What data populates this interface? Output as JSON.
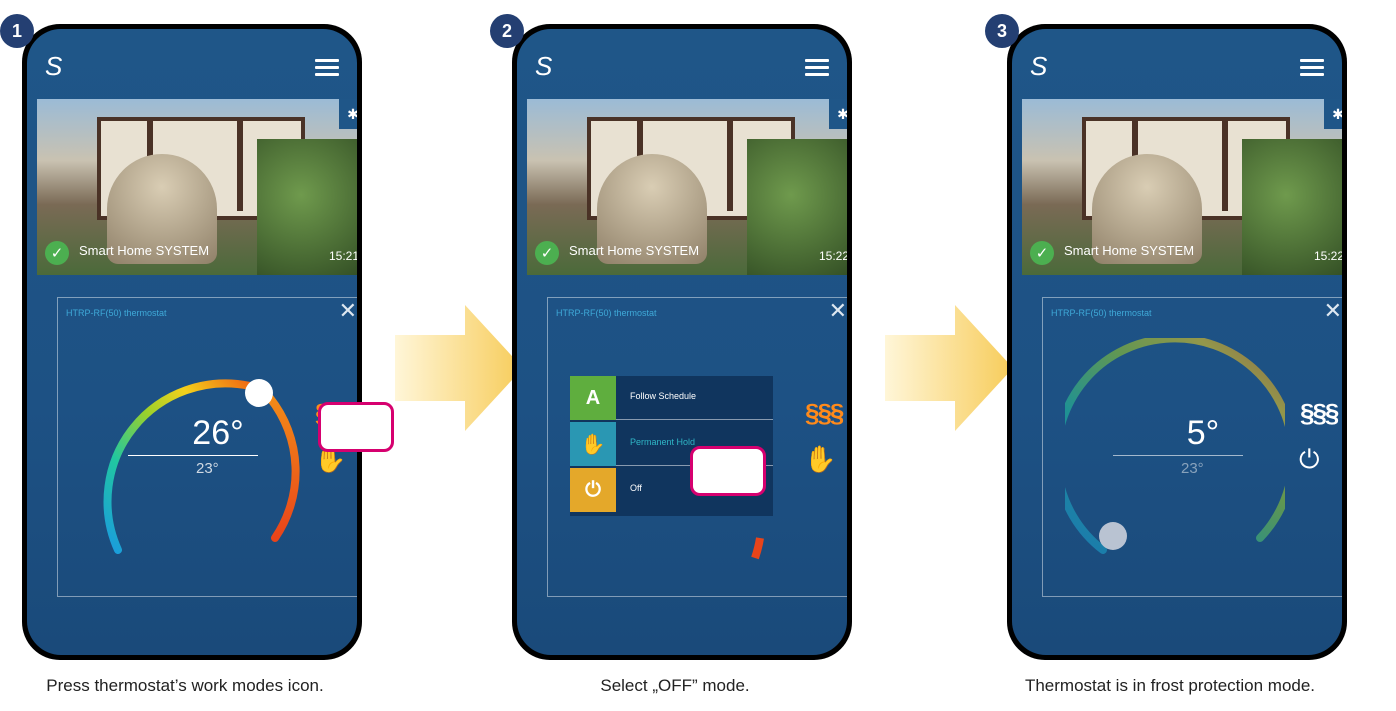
{
  "steps": [
    {
      "number": "1",
      "caption": "Press thermostat’s work modes icon.",
      "system_name": "Smart Home SYSTEM",
      "time": "15:21",
      "panel_title": "HTRP-RF(50) thermostat",
      "current_temp": "26°",
      "target_temp": "23°",
      "mode_icon": "hand-icon"
    },
    {
      "number": "2",
      "caption": "Select „OFF” mode.",
      "system_name": "Smart Home SYSTEM",
      "time": "15:22",
      "panel_title": "HTRP-RF(50) thermostat",
      "menu": [
        {
          "label": "Follow Schedule",
          "icon": "auto-schedule-icon",
          "color": "#5fae3e"
        },
        {
          "label": "Permanent Hold",
          "icon": "hand-icon",
          "color": "#2a97b3"
        },
        {
          "label": "Off",
          "icon": "power-icon",
          "color": "#e4a82a"
        }
      ],
      "mode_icon": "hand-icon"
    },
    {
      "number": "3",
      "caption": "Thermostat is in frost protection mode.",
      "system_name": "Smart Home SYSTEM",
      "time": "15:22",
      "panel_title": "HTRP-RF(50) thermostat",
      "current_temp": "5°",
      "target_temp": "23°",
      "mode_icon": "power-icon"
    }
  ],
  "colors": {
    "badge": "#243f72",
    "screen": "#1f5688",
    "heat_active": "#ff8a1a",
    "arrow": "#f7cc5a",
    "pointer": "#d6006f"
  }
}
